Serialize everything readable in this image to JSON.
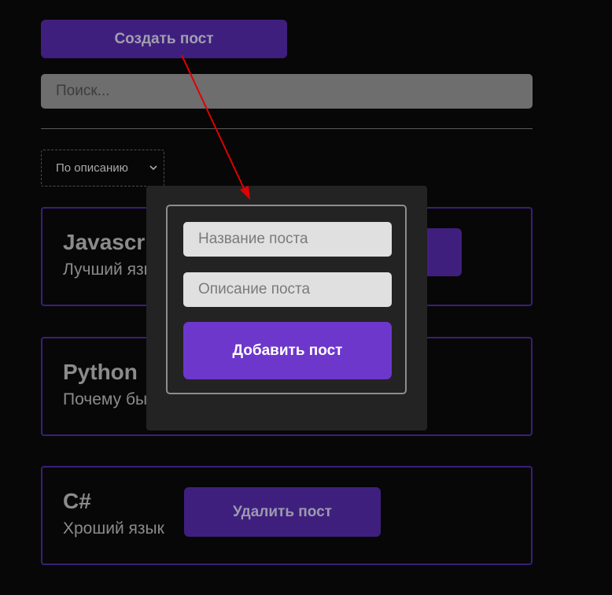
{
  "toolbar": {
    "create_label": "Создать пост",
    "search_placeholder": "Поиск...",
    "sort_selected": "По описанию"
  },
  "posts": [
    {
      "title": "Javascript",
      "description": "Лучший язык",
      "delete_label": ""
    },
    {
      "title": "Python",
      "description": "Почему бы и нет",
      "delete_label": ""
    },
    {
      "title": "C#",
      "description": "Хроший язык",
      "delete_label": "Удалить пост"
    }
  ],
  "modal": {
    "title_placeholder": "Название поста",
    "description_placeholder": "Описание поста",
    "add_label": "Добавить пост"
  },
  "colors": {
    "background": "#070707",
    "accent": "#3f1f7e",
    "accent_active": "#6d37cc",
    "annotation_arrow": "#e00000"
  }
}
